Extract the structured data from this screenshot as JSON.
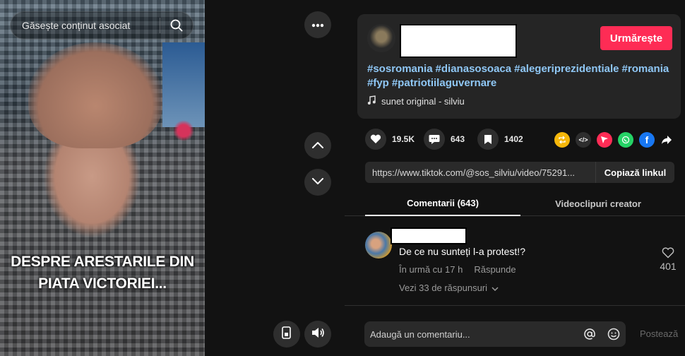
{
  "video": {
    "search_text": "Găsește conținut asociat",
    "caption_line1": "DESPRE ARESTARILE DIN",
    "caption_line2": "PIATA VICTORIEI..."
  },
  "post": {
    "follow_label": "Urmărește",
    "hashtags": [
      "#sosromania",
      "#dianasosoaca",
      "#alegeriprezidentiale",
      "#romania",
      "#fyp",
      "#patriotiilaguvernare"
    ],
    "sound_label": "sunet original - silviu"
  },
  "stats": {
    "likes": "19.5K",
    "comments": "643",
    "saves": "1402"
  },
  "link": {
    "url": "https://www.tiktok.com/@sos_silviu/video/75291...",
    "copy_label": "Copiază linkul"
  },
  "tabs": {
    "comments": "Comentarii (643)",
    "creator_videos": "Videoclipuri creator"
  },
  "comment": {
    "text": "De ce nu sunteți l-a protest!?",
    "time": "În urmă cu 17 h",
    "reply_label": "Răspunde",
    "view_replies": "Vezi 33 de răspunsuri",
    "likes": "401"
  },
  "composer": {
    "placeholder": "Adaugă un comentariu...",
    "post_label": "Postează"
  },
  "colors": {
    "accent": "#fe2c55",
    "hashtag": "#8fc7f5",
    "background": "#121212"
  }
}
